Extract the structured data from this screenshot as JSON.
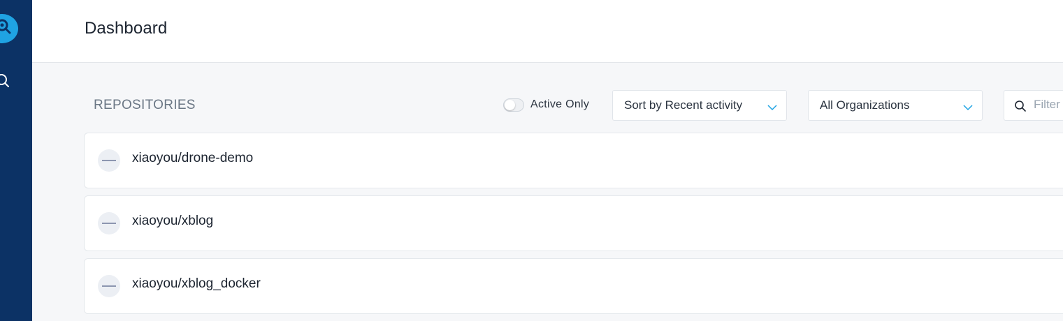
{
  "app": {
    "logo_icon": "drone-logo-icon",
    "accent": "#1fa3e3",
    "sidebar_color": "#0c3265"
  },
  "sidebar": {
    "search_icon": "search-icon"
  },
  "header": {
    "title": "Dashboard"
  },
  "repositories": {
    "section_title": "REPOSITORIES",
    "active_only_label": "Active Only",
    "active_only_on": false,
    "sort_select": "Sort by Recent activity",
    "org_select": "All Organizations",
    "filter_placeholder": "Filter",
    "items": [
      {
        "name": "xiaoyou/drone-demo",
        "status_icon": "no-builds-icon"
      },
      {
        "name": "xiaoyou/xblog",
        "status_icon": "no-builds-icon"
      },
      {
        "name": "xiaoyou/xblog_docker",
        "status_icon": "no-builds-icon"
      }
    ]
  }
}
